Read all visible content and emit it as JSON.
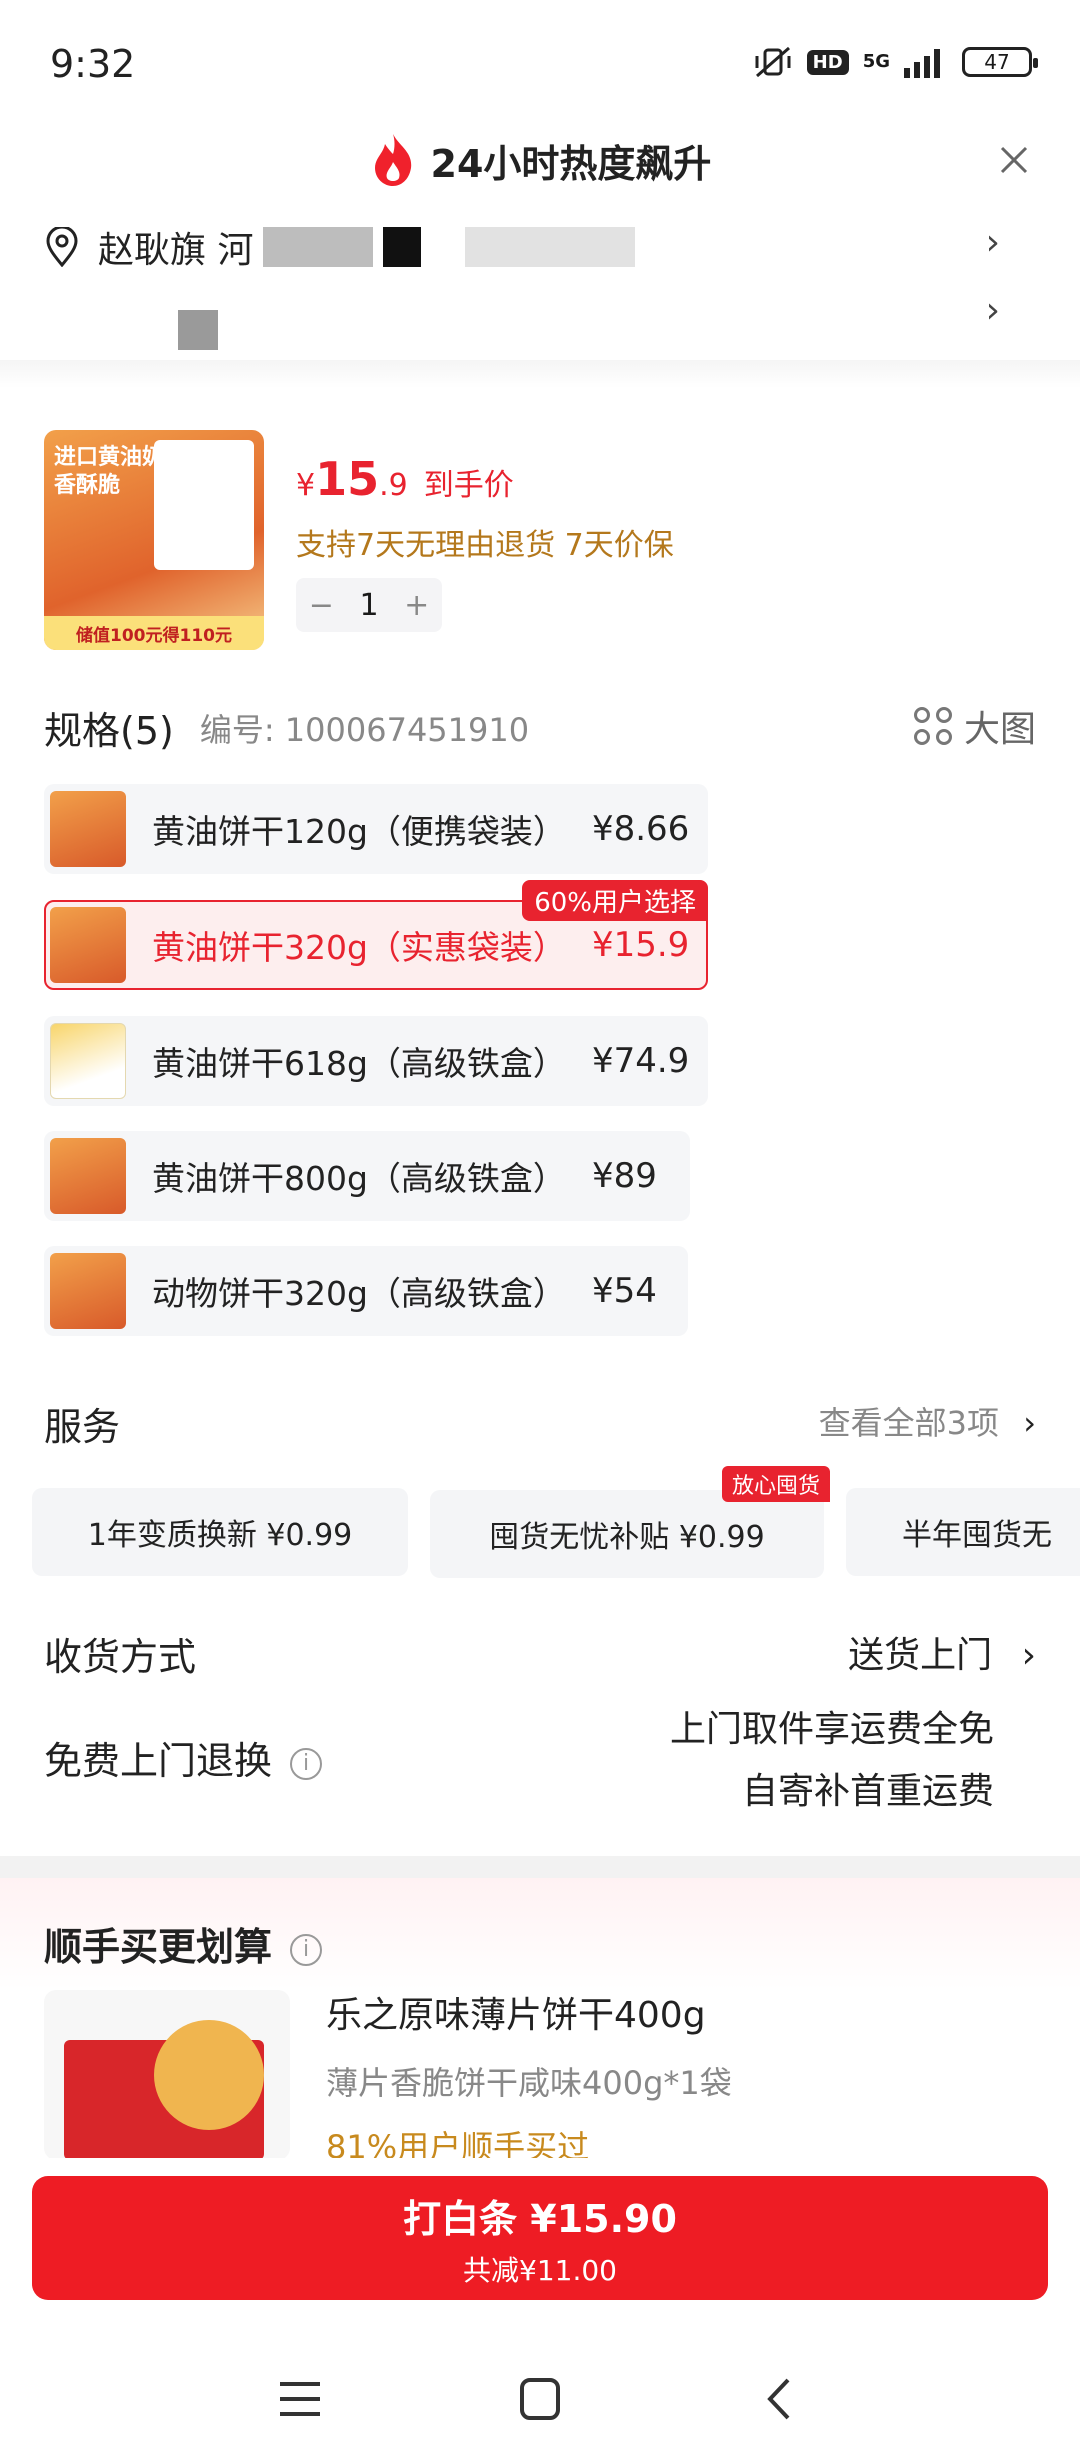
{
  "status_bar": {
    "time": "9:32",
    "hd": "HD",
    "network": "5G",
    "battery": "47"
  },
  "header": {
    "title": "24小时热度飙升"
  },
  "address": {
    "line1": "赵耿旗 河"
  },
  "product": {
    "image_text": "进口黄油奶香酥脆",
    "image_banner": "储值100元得110元",
    "price_symbol": "¥",
    "price_int": "15",
    "price_dec": ".9",
    "price_suffix": "到手价",
    "guarantee": "支持7天无理由退货  7天价保",
    "quantity": "1",
    "minus": "−",
    "plus": "+"
  },
  "spec": {
    "title": "规格(5)",
    "code": "编号: 100067451910",
    "big_image": "大图",
    "items": [
      {
        "name": "黄油饼干120g（便携袋装）",
        "price": "¥8.66"
      },
      {
        "name": "黄油饼干320g（实惠袋装）",
        "price": "¥15.9",
        "tag": "60%用户选择"
      },
      {
        "name": "黄油饼干618g（高级铁盒）",
        "price": "¥74.9"
      },
      {
        "name": "黄油饼干800g（高级铁盒）",
        "price": "¥89"
      },
      {
        "name": "动物饼干320g（高级铁盒）",
        "price": "¥54"
      }
    ]
  },
  "service": {
    "title": "服务",
    "more": "查看全部3项",
    "cards": [
      {
        "label": "1年变质换新   ¥0.99"
      },
      {
        "label": "囤货无忧补贴   ¥0.99",
        "badge": "放心囤货"
      },
      {
        "label": "半年囤货无"
      }
    ]
  },
  "delivery": {
    "title": "收货方式",
    "value": "送货上门"
  },
  "return": {
    "title": "免费上门退换",
    "line1": "上门取件享运费全免",
    "line2": "自寄补首重运费"
  },
  "recommend": {
    "title": "顺手买更划算",
    "name": "乐之原味薄片饼干400g",
    "desc": "薄片香脆饼干咸味400g*1袋",
    "stat": "81%用户顺手买过"
  },
  "buy": {
    "main": "打白条 ¥15.90",
    "sub": "共减¥11.00"
  },
  "colors": {
    "accent": "#ee1c24",
    "gold": "#b4781c"
  }
}
